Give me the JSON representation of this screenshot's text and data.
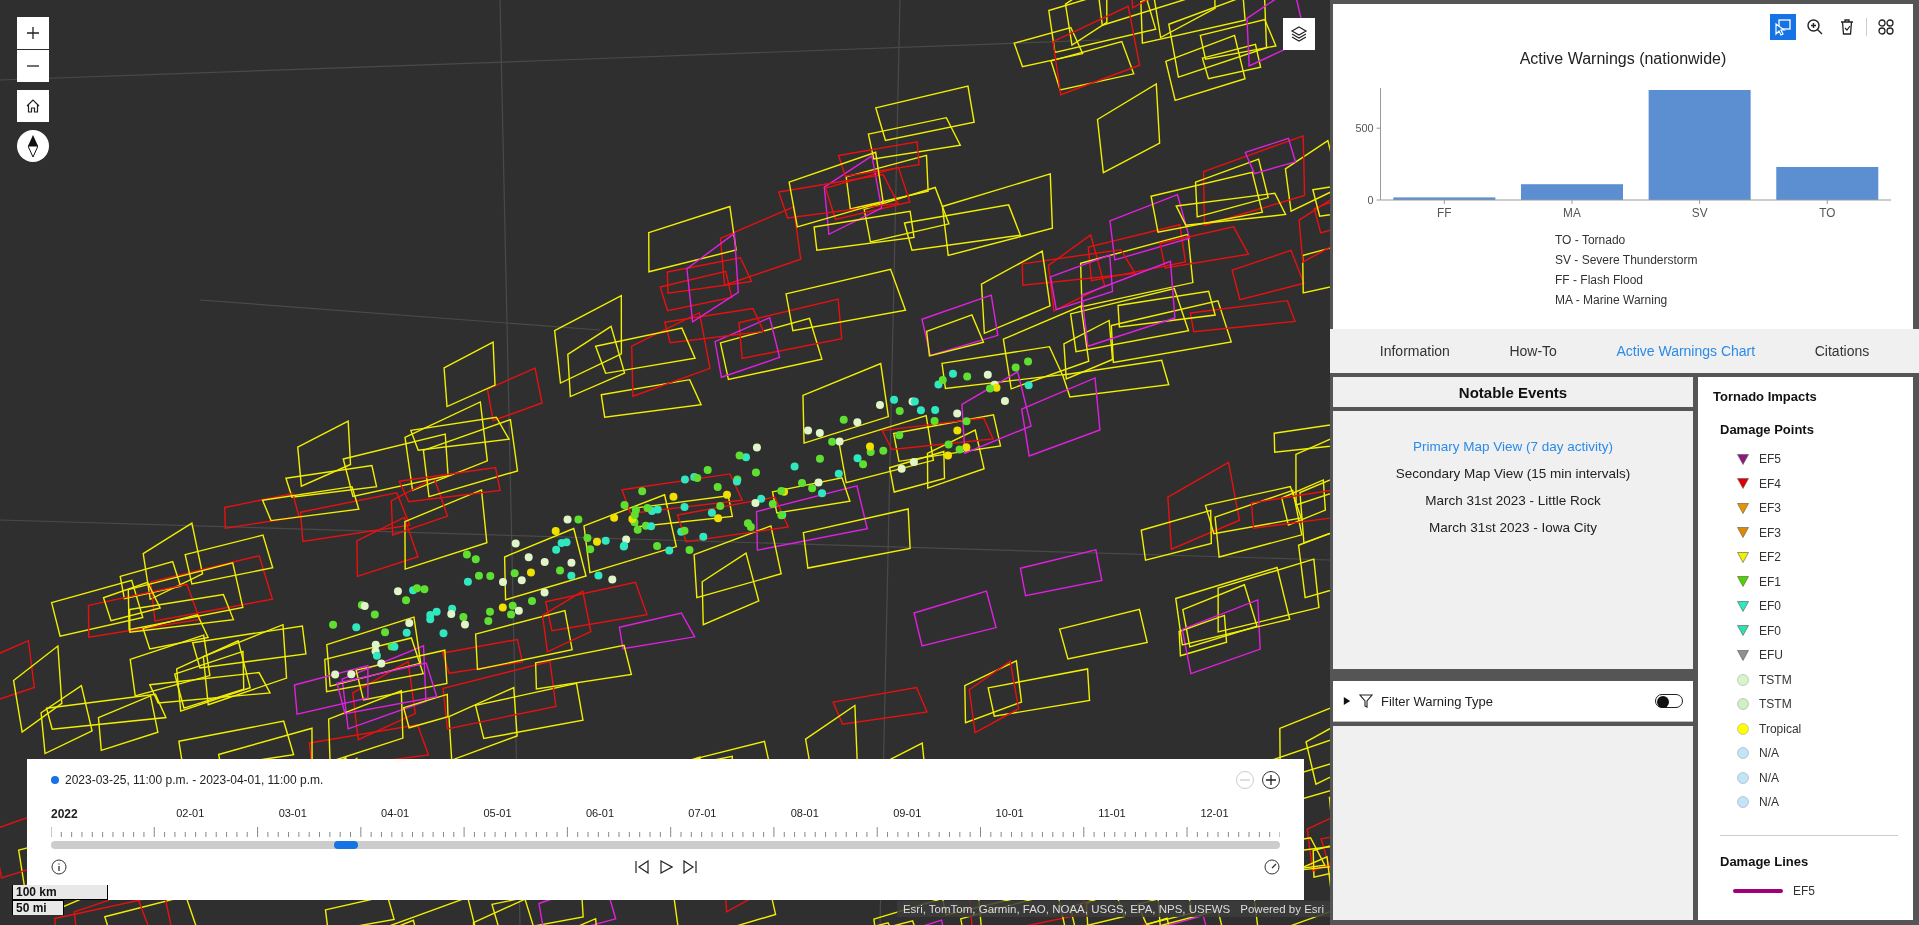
{
  "map": {
    "scale_bar": {
      "metric": "100 km",
      "imperial": "50 mi"
    },
    "attribution": {
      "sources": "Esri, TomTom, Garmin, FAO, NOAA, USGS, EPA, NPS, USFWS",
      "powered_by": "Powered by Esri"
    }
  },
  "time_slider": {
    "extent": "2023-03-25, 11:00 p.m. - 2023-04-01, 11:00 p.m.",
    "zoom_buttons": [
      {
        "kind": "zoom-out",
        "disabled": true
      },
      {
        "kind": "zoom-in",
        "disabled": false
      }
    ],
    "year": "2022",
    "months": [
      "02-01",
      "03-01",
      "04-01",
      "05-01",
      "06-01",
      "07-01",
      "08-01",
      "09-01",
      "10-01",
      "11-01",
      "12-01"
    ],
    "level": 0.24
  },
  "chart_panel": {
    "toolbar": [
      {
        "kind": "select",
        "selected": true
      },
      {
        "kind": "zoom",
        "selected": false
      },
      {
        "kind": "clear",
        "selected": false
      },
      {
        "kind": "layout",
        "selected": false
      }
    ],
    "chart_data": {
      "type": "bar",
      "title": "Active Warnings (nationwide)",
      "categories": [
        "FF",
        "MA",
        "SV",
        "TO"
      ],
      "values": [
        18,
        110,
        766,
        230
      ],
      "ylim": [
        0,
        780
      ],
      "yticks": [
        0,
        500
      ]
    },
    "legend": [
      "TO - Tornado",
      "SV - Severe Thunderstorm",
      "FF - Flash Flood",
      "MA - Marine Warning"
    ]
  },
  "tabs": [
    {
      "label": "Information",
      "selected": false
    },
    {
      "label": "How-To",
      "selected": false
    },
    {
      "label": "Active Warnings Chart",
      "selected": true
    },
    {
      "label": "Citations",
      "selected": false
    }
  ],
  "notable_events": {
    "title": "Notable Events",
    "items": [
      {
        "label": "Primary Map View (7 day activity)",
        "selected": true
      },
      {
        "label": "Secondary Map View (15 min intervals)",
        "selected": false
      },
      {
        "label": "March 31st 2023 - Little Rock",
        "selected": false
      },
      {
        "label": "March 31st 2023 - Iowa City",
        "selected": false
      }
    ]
  },
  "filter": {
    "label": "Filter Warning Type",
    "expanded": false,
    "on": false
  },
  "tornado_impacts": {
    "title": "Tornado Impacts",
    "damage_points": {
      "title": "Damage Points",
      "items": [
        {
          "label": "EF5",
          "kind": "triangle",
          "color": "#8e1a7e"
        },
        {
          "label": "EF4",
          "kind": "triangle",
          "color": "#e00000"
        },
        {
          "label": "EF3",
          "kind": "triangle",
          "color": "#e89400"
        },
        {
          "label": "EF3",
          "kind": "triangle",
          "color": "#e08a00"
        },
        {
          "label": "EF2",
          "kind": "triangle",
          "color": "#f5f000"
        },
        {
          "label": "EF1",
          "kind": "triangle",
          "color": "#4fd400"
        },
        {
          "label": "EF0",
          "kind": "triangle",
          "color": "#2ee8c0"
        },
        {
          "label": "EF0",
          "kind": "triangle",
          "color": "#30e0b0"
        },
        {
          "label": "EFU",
          "kind": "triangle",
          "color": "#909090"
        },
        {
          "label": "TSTM",
          "kind": "circle",
          "color": "#d8f5c8"
        },
        {
          "label": "TSTM",
          "kind": "circle",
          "color": "#d0f0c0"
        },
        {
          "label": "Tropical",
          "kind": "circle",
          "color": "#ffff00"
        },
        {
          "label": "N/A",
          "kind": "circle",
          "color": "#c0e4f8"
        },
        {
          "label": "N/A",
          "kind": "circle",
          "color": "#c0e4f8"
        },
        {
          "label": "N/A",
          "kind": "circle",
          "color": "#c0e4f8"
        }
      ]
    },
    "damage_lines": {
      "title": "Damage Lines",
      "items": [
        {
          "label": "EF5",
          "color": "#a0007a"
        }
      ]
    }
  }
}
